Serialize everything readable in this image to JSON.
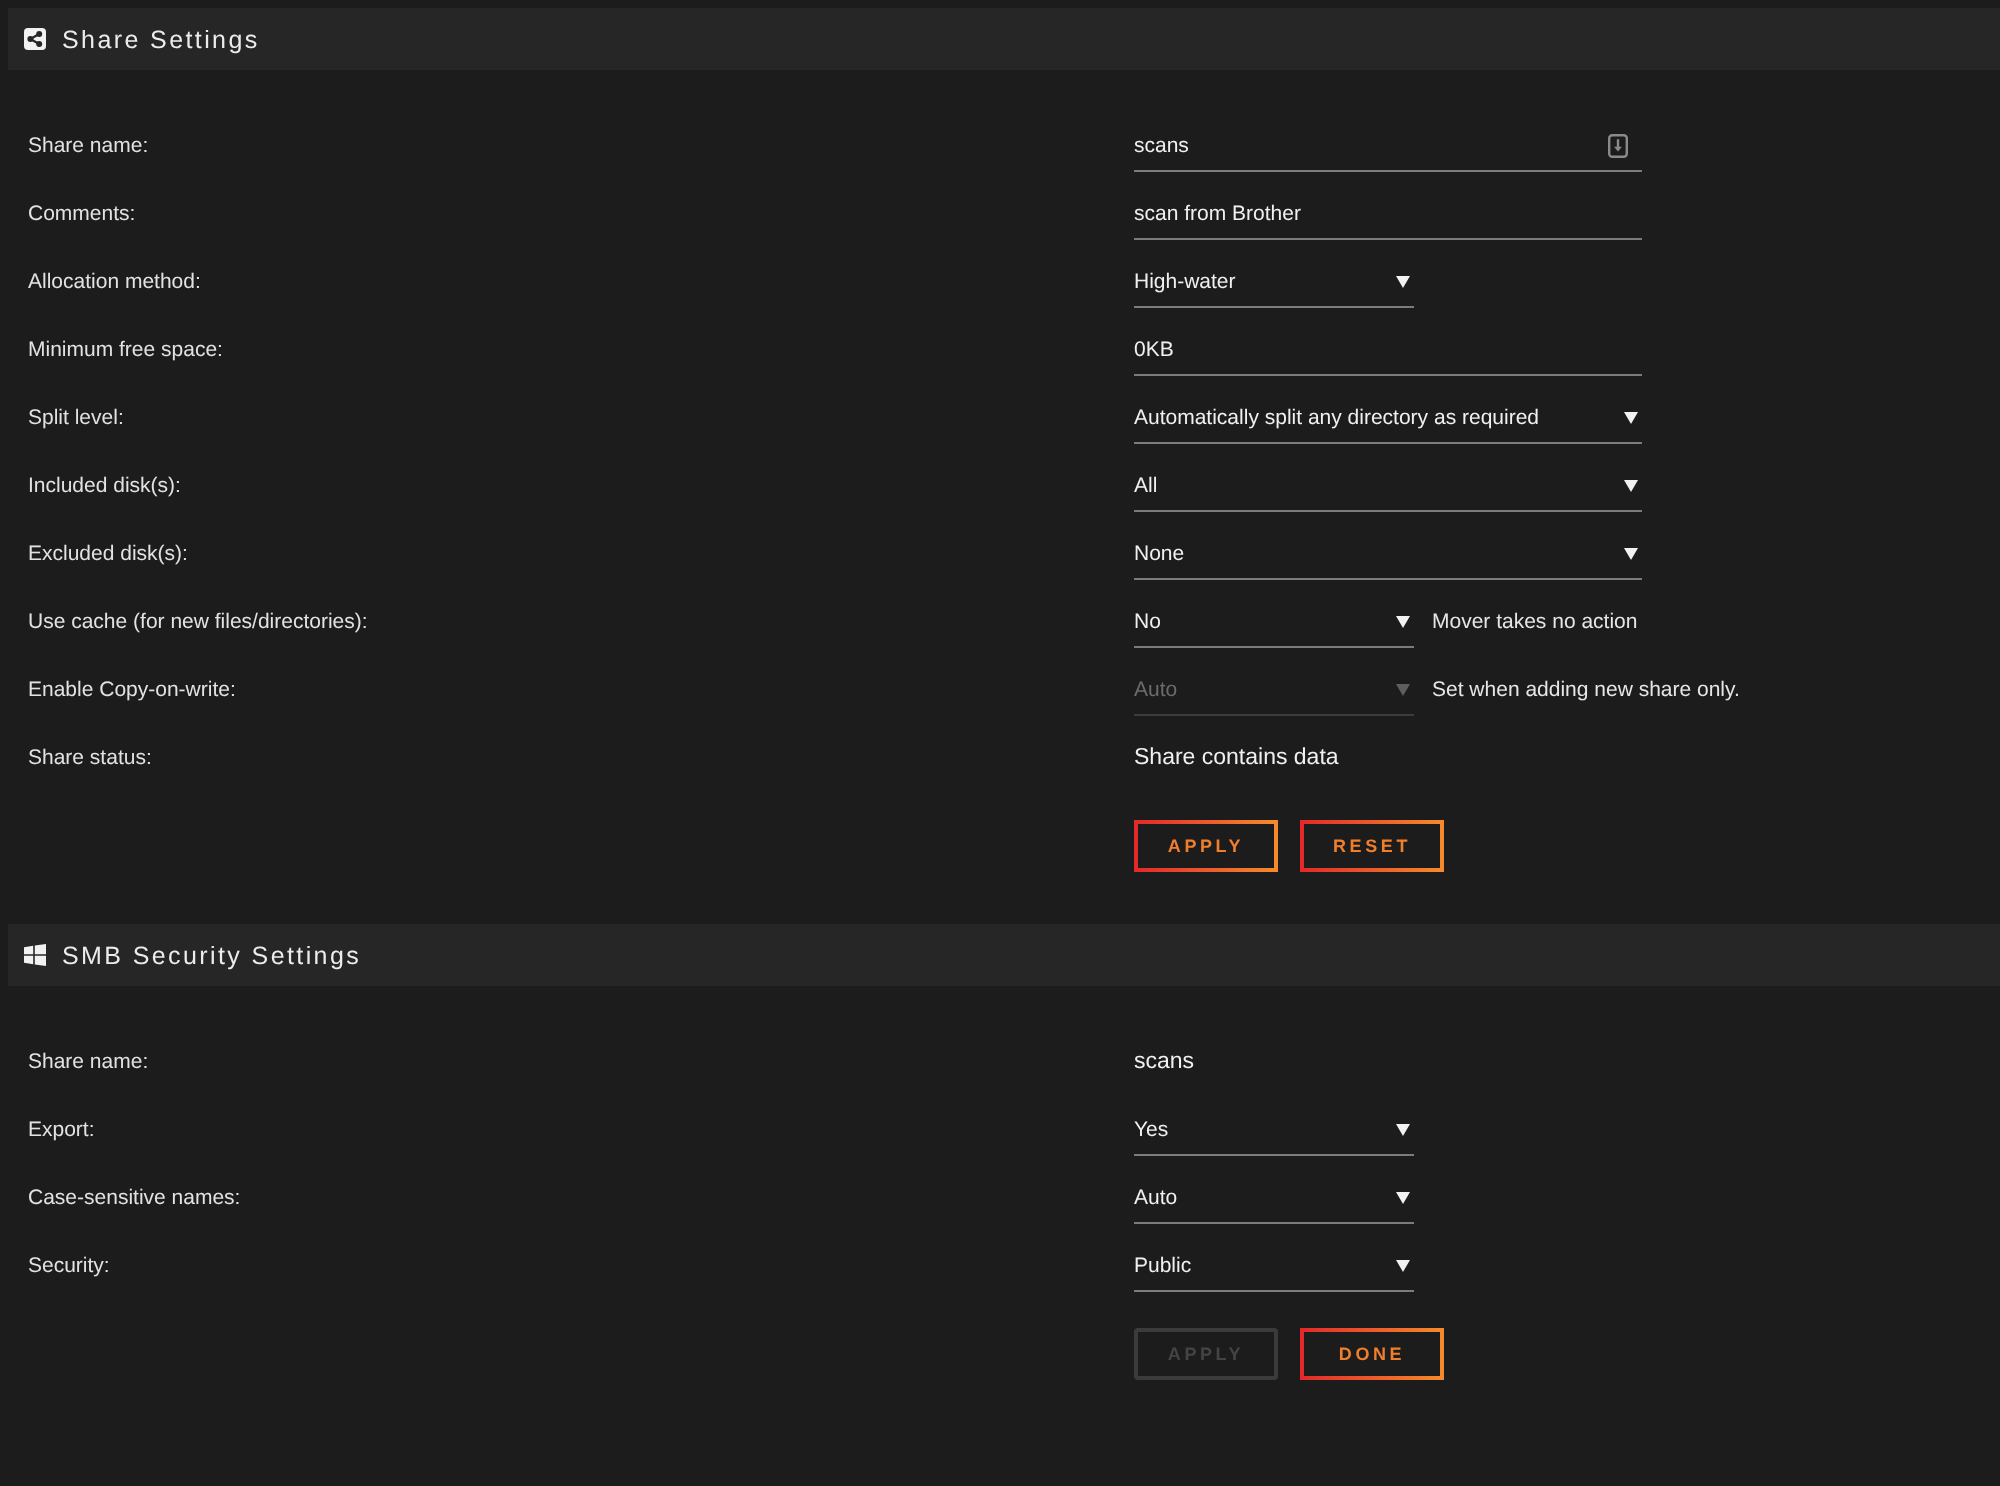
{
  "sections": [
    {
      "kind": "share",
      "title": "Share Settings",
      "rows": [
        {
          "label": "Share name:",
          "kind": "input",
          "value": "scans",
          "disabled": false,
          "trailing_icon": true
        },
        {
          "label": "Comments:",
          "kind": "input",
          "value": "scan from Brother",
          "disabled": false
        },
        {
          "label": "Allocation method:",
          "kind": "select",
          "value": "High-water",
          "disabled": false
        },
        {
          "label": "Minimum free space:",
          "kind": "input",
          "value": "0KB",
          "disabled": false
        },
        {
          "label": "Split level:",
          "kind": "select-wide",
          "value": "Automatically split any directory as required",
          "disabled": false
        },
        {
          "label": "Included disk(s):",
          "kind": "select-wide",
          "value": "All",
          "disabled": false
        },
        {
          "label": "Excluded disk(s):",
          "kind": "select-wide",
          "value": "None",
          "disabled": false
        },
        {
          "label": "Use cache (for new files/directories):",
          "kind": "select",
          "value": "No",
          "disabled": false,
          "note": "Mover takes no action"
        },
        {
          "label": "Enable Copy-on-write:",
          "kind": "select",
          "value": "Auto",
          "disabled": true,
          "note": "Set when adding new share only."
        },
        {
          "label": "Share status:",
          "kind": "text",
          "value": "Share contains data",
          "disabled": false
        }
      ],
      "buttons": [
        {
          "label": "APPLY",
          "disabled": false
        },
        {
          "label": "RESET",
          "disabled": false
        }
      ]
    },
    {
      "kind": "smb",
      "title": "SMB Security Settings",
      "rows": [
        {
          "label": "Share name:",
          "kind": "text",
          "value": "scans",
          "disabled": false
        },
        {
          "label": "Export:",
          "kind": "select",
          "value": "Yes",
          "disabled": false
        },
        {
          "label": "Case-sensitive names:",
          "kind": "select",
          "value": "Auto",
          "disabled": false
        },
        {
          "label": "Security:",
          "kind": "select",
          "value": "Public",
          "disabled": false
        }
      ],
      "buttons": [
        {
          "label": "APPLY",
          "disabled": true
        },
        {
          "label": "DONE",
          "disabled": false
        }
      ]
    }
  ]
}
